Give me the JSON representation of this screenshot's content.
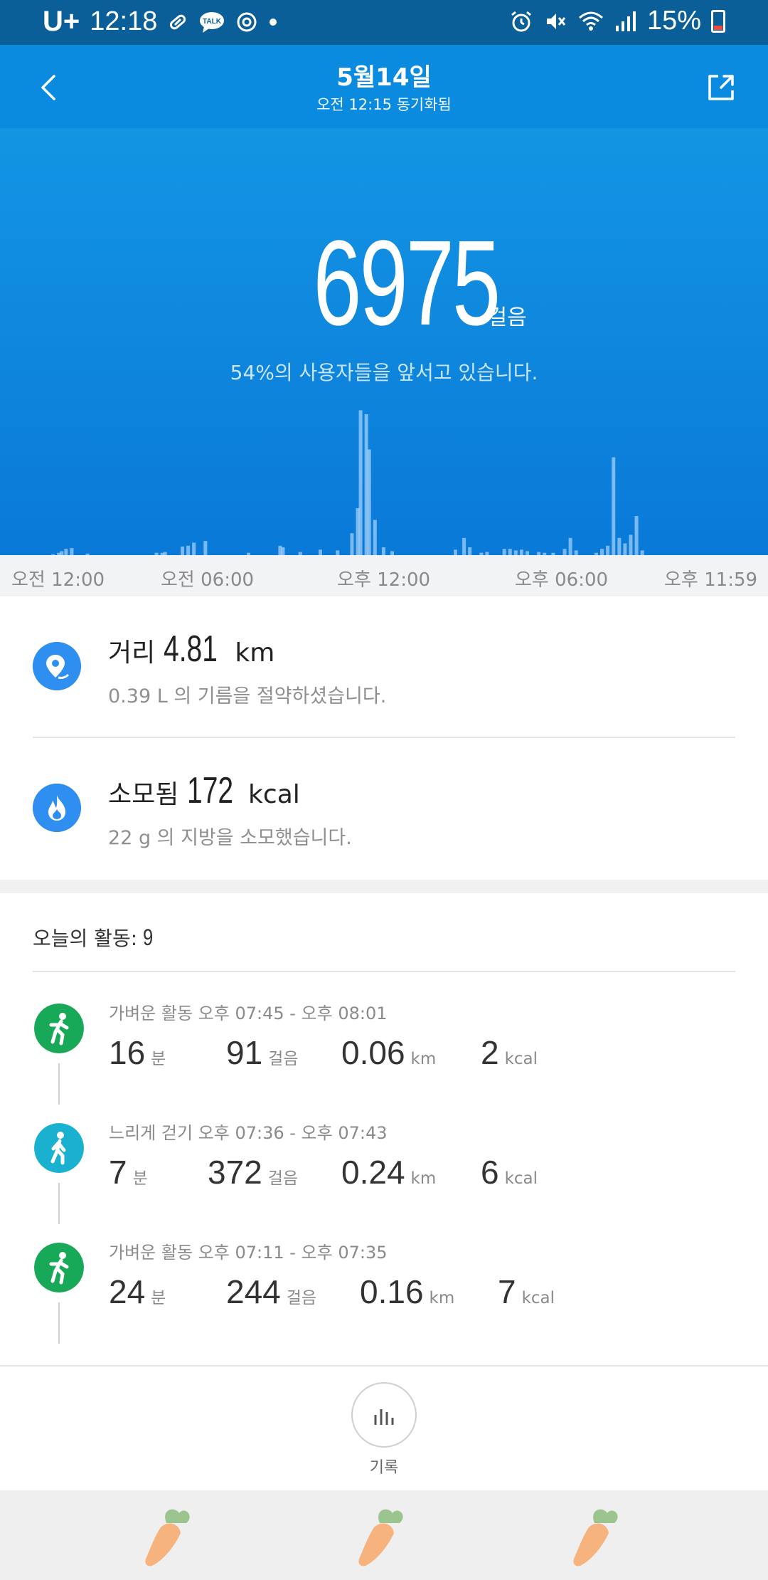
{
  "status_bar": {
    "carrier": "U+",
    "time": "12:18",
    "talk_badge": "TALK",
    "battery": "15%",
    "icons": [
      "pill-icon",
      "talk-icon",
      "sync-icon",
      "dot-icon",
      "alarm-icon",
      "mute-icon",
      "wifi-icon",
      "signal-icon",
      "battery-icon"
    ]
  },
  "header": {
    "title": "5월14일",
    "subtitle": "오전 12:15 동기화됨"
  },
  "hero": {
    "steps": "6975",
    "steps_unit": "걸음",
    "rank_text": "54%의 사용자들을 앞서고 있습니다.",
    "colors": {
      "top": "#1395e3",
      "bottom": "#0a79d8"
    }
  },
  "chart_data": {
    "type": "bar",
    "xlabel": "",
    "ylabel": "",
    "x_ticks": [
      "오전 12:00",
      "오전 06:00",
      "오후 12:00",
      "오후 06:00",
      "오후 11:59"
    ],
    "x_range_hours": [
      0,
      24
    ],
    "hours": [
      0.3,
      0.5,
      0.6,
      0.75,
      0.95,
      1.5,
      3.9,
      4.1,
      4.2,
      4.8,
      5.0,
      5.2,
      5.6,
      7.1,
      8.2,
      8.3,
      8.9,
      9.6,
      10.2,
      10.7,
      10.9,
      11.0,
      11.2,
      11.3,
      11.5,
      11.8,
      12.1,
      14.3,
      14.6,
      14.8,
      15.2,
      15.4,
      16.0,
      16.2,
      16.4,
      16.6,
      16.8,
      17.2,
      17.4,
      17.7,
      18.1,
      18.3,
      18.5,
      19.2,
      19.4,
      19.6,
      19.8,
      20.0,
      20.2,
      20.4,
      20.6,
      20.8
    ],
    "values": [
      1,
      3,
      5,
      8,
      9,
      2,
      3,
      3,
      4,
      11,
      12,
      16,
      18,
      3,
      12,
      10,
      4,
      7,
      6,
      28,
      60,
      185,
      180,
      135,
      45,
      10,
      5,
      7,
      22,
      10,
      3,
      4,
      8,
      8,
      6,
      7,
      5,
      4,
      3,
      3,
      8,
      22,
      6,
      3,
      8,
      12,
      125,
      22,
      15,
      26,
      50,
      6
    ],
    "ylim": [
      0,
      200
    ]
  },
  "axis": {
    "labels": [
      "오전 12:00",
      "오전 06:00",
      "오후 12:00",
      "오후 06:00",
      "오후 11:59"
    ]
  },
  "stats": {
    "distance": {
      "label": "거리",
      "value": "4.81",
      "unit": "km",
      "sub": "0.39 L 의 기름을 절약하셨습니다.",
      "icon": "map-pin-icon"
    },
    "calories": {
      "label": "소모됨",
      "value": "172",
      "unit": "kcal",
      "sub": "22 g 의 지방을 소모했습니다.",
      "icon": "flame-icon"
    }
  },
  "activities": {
    "header_label": "오늘의 활동:",
    "count": "9",
    "items": [
      {
        "title": "가벼운 활동 오후 07:45 - 오후 08:01",
        "minutes": "16",
        "min_unit": "분",
        "steps": "91",
        "steps_unit": "걸음",
        "km": "0.06",
        "km_unit": "km",
        "kcal": "2",
        "kcal_unit": "kcal",
        "color": "#17a957",
        "icon": "light-activity-icon"
      },
      {
        "title": "느리게 걷기 오후 07:36 - 오후 07:43",
        "minutes": "7",
        "min_unit": "분",
        "steps": "372",
        "steps_unit": "걸음",
        "km": "0.24",
        "km_unit": "km",
        "kcal": "6",
        "kcal_unit": "kcal",
        "color": "#1ab0cf",
        "icon": "walking-icon"
      },
      {
        "title": "가벼운 활동 오후 07:11 - 오후 07:35",
        "minutes": "24",
        "min_unit": "분",
        "steps": "244",
        "steps_unit": "걸음",
        "km": "0.16",
        "km_unit": "km",
        "kcal": "7",
        "kcal_unit": "kcal",
        "color": "#17a957",
        "icon": "light-activity-icon"
      }
    ]
  },
  "bottom": {
    "record_label": "기록",
    "record_icon": "bar-chart-icon"
  },
  "ad": {
    "icons": [
      "carrot-icon",
      "carrot-icon",
      "carrot-icon"
    ]
  }
}
